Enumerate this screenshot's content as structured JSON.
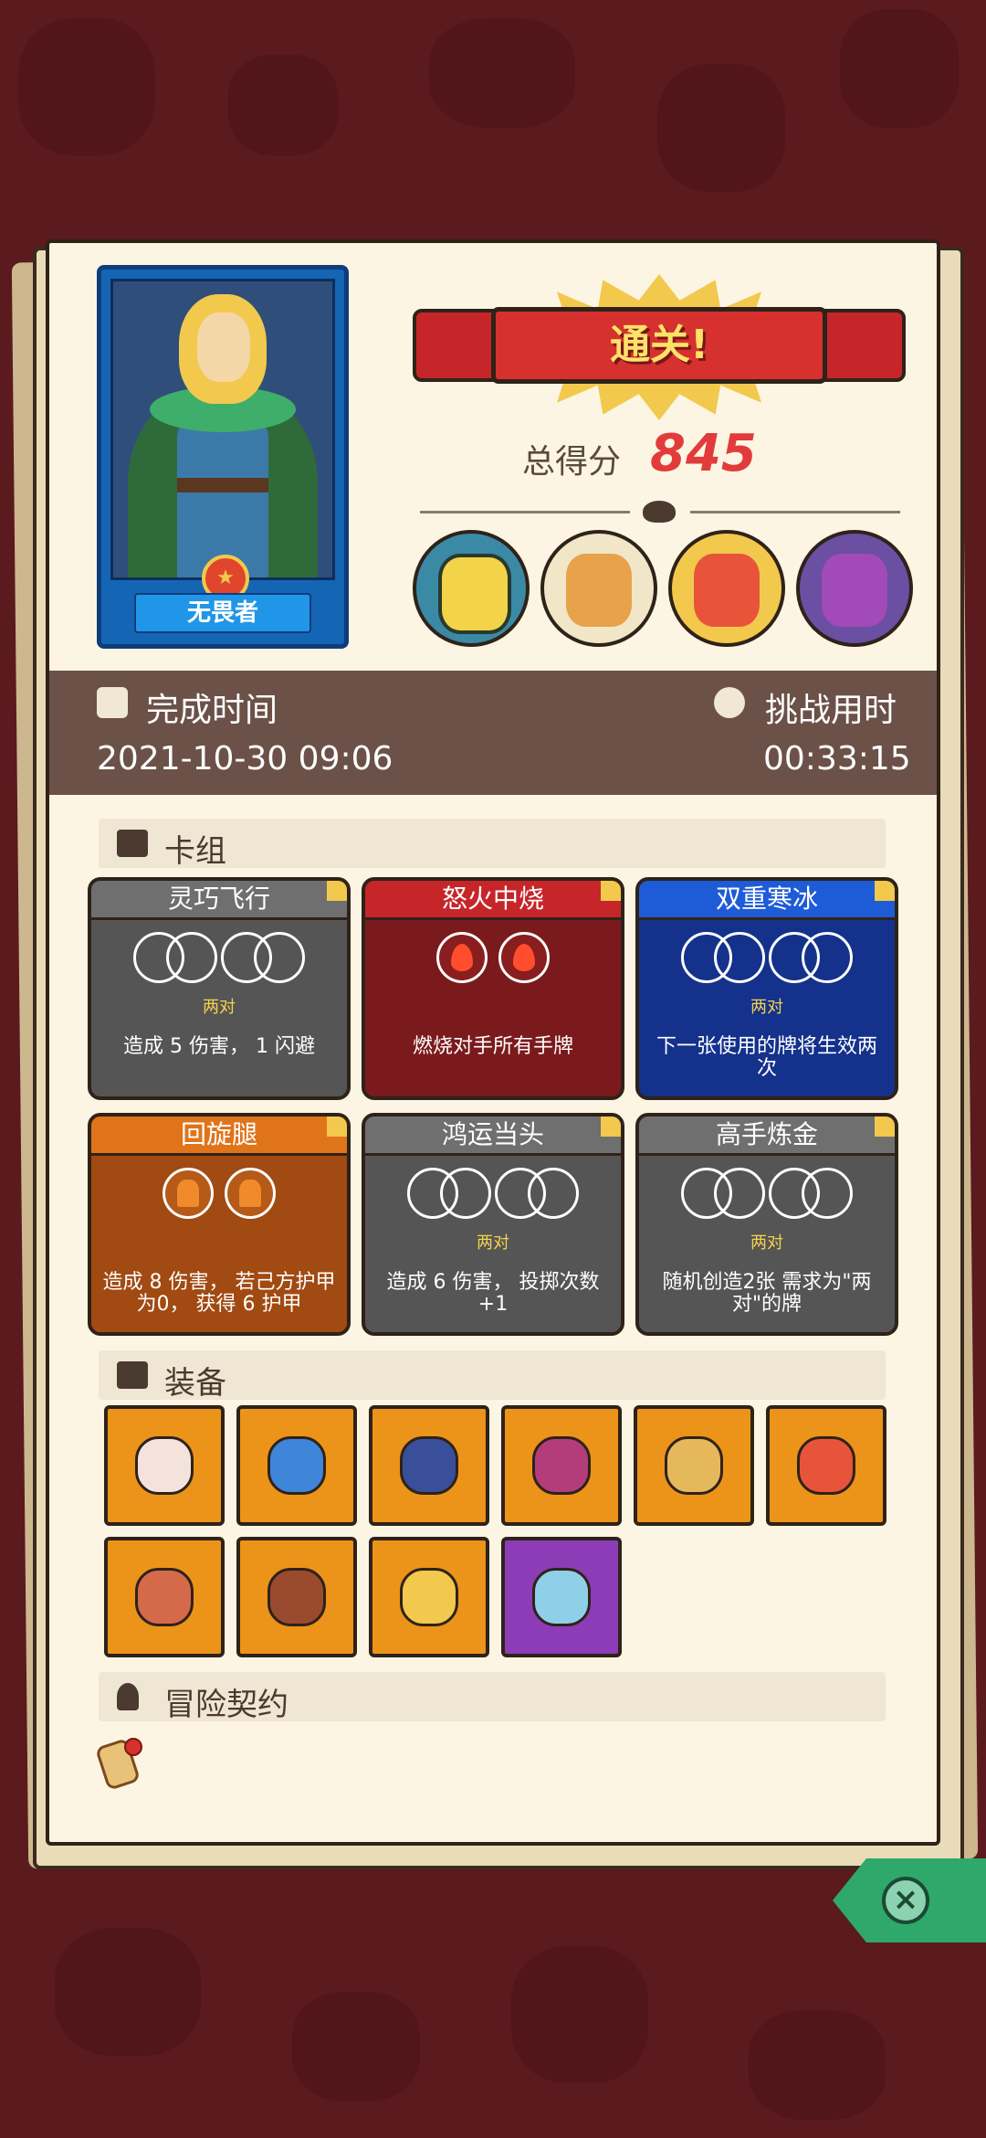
{
  "hero": {
    "title": "无畏者"
  },
  "result": {
    "banner": "通关!",
    "score_label": "总得分",
    "score": "845"
  },
  "bosses": [
    "knight-boss",
    "ogre-boss",
    "jester-boss",
    "dragon-boss"
  ],
  "time_bar": {
    "completed_label": "完成时间",
    "completed_value": "2021-10-30 09:06",
    "elapsed_label": "挑战用时",
    "elapsed_value": "00:33:15"
  },
  "sections": {
    "deck": "卡组",
    "equipment": "装备",
    "contract": "冒险契约"
  },
  "cards": [
    {
      "name": "灵巧飞行",
      "color": "#555555",
      "cap": "#6f6f6f",
      "req": "两对",
      "desc": "造成 5 伤害， 1 闪避",
      "dice": "pairs"
    },
    {
      "name": "怒火中烧",
      "color": "#7b1a1c",
      "cap": "#c6262a",
      "req": "",
      "desc": "燃烧对手所有手牌",
      "dice": "fire"
    },
    {
      "name": "双重寒冰",
      "color": "#14318c",
      "cap": "#1e5bd6",
      "req": "两对",
      "desc": "下一张使用的牌将生效两次",
      "dice": "pairs"
    },
    {
      "name": "回旋腿",
      "color": "#a14a12",
      "cap": "#e0741b",
      "req": "",
      "desc": "造成 8 伤害， 若己方护甲为0， 获得 6 护甲",
      "dice": "boot"
    },
    {
      "name": "鸿运当头",
      "color": "#555555",
      "cap": "#6f6f6f",
      "req": "两对",
      "desc": "造成 6 伤害， 投掷次数+1",
      "dice": "pairs"
    },
    {
      "name": "高手炼金",
      "color": "#555555",
      "cap": "#6f6f6f",
      "req": "两对",
      "desc": "随机创造2张 需求为\"两对\"的牌",
      "dice": "pairs"
    }
  ],
  "equipment": [
    {
      "icon": "jar-icon",
      "rarity": "orange"
    },
    {
      "icon": "blue-slime-icon",
      "rarity": "orange"
    },
    {
      "icon": "hexagram-icon",
      "rarity": "orange"
    },
    {
      "icon": "cursed-heart-icon",
      "rarity": "orange"
    },
    {
      "icon": "coin-bag-icon",
      "rarity": "orange"
    },
    {
      "icon": "fire-feather-icon",
      "rarity": "orange"
    },
    {
      "icon": "ham-icon",
      "rarity": "orange"
    },
    {
      "icon": "coin-plate-icon",
      "rarity": "orange"
    },
    {
      "icon": "gold-coin-icon",
      "rarity": "orange"
    },
    {
      "icon": "ice-dagger-icon",
      "rarity": "purple"
    }
  ],
  "contract": {
    "icon": "scroll-icon"
  },
  "close": {
    "icon": "close-icon"
  }
}
